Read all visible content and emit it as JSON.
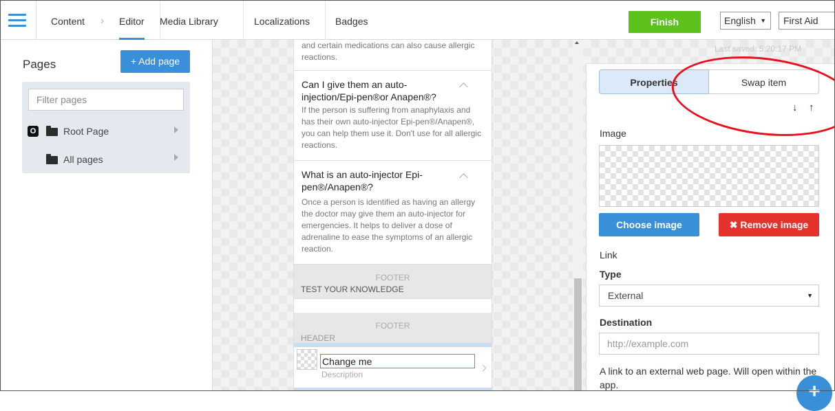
{
  "topbar": {
    "tabs": [
      "Content",
      "Editor",
      "Media Library",
      "Localizations",
      "Badges"
    ],
    "finish_label": "Finish",
    "language": "English",
    "project": "First Aid"
  },
  "sidebar": {
    "title": "Pages",
    "add_label": "+ Add page",
    "filter_placeholder": "Filter pages",
    "badge_letter": "O",
    "root_label": "Root Page",
    "all_label": "All pages"
  },
  "preview": {
    "top_text": "and certain medications can also cause allergic reactions.",
    "item1": {
      "title": "Can I give them an auto-injection/Epi-pen®or Anapen®?",
      "body": "If the person is suffering from anaphylaxis and has their own auto-injector Epi-pen®/Anapen®, you can help them use it. Don't use for all allergic reactions."
    },
    "item2": {
      "title": "What is an auto-injector Epi-pen®/Anapen®?",
      "body": "Once a person is identified as having an allergy the doctor may give them an auto-injector for emergencies. It helps to deliver a dose of adrenaline to ease the symptoms of an allergic reaction."
    },
    "footer_caption": "FOOTER",
    "test_label": "TEST YOUR KNOWLEDGE",
    "header_label": "HEADER",
    "change_value": "Change me",
    "description": "Description"
  },
  "properties": {
    "last_saved": "Last saved: 5:20:17 PM",
    "tab_properties": "Properties",
    "tab_swap": "Swap item",
    "image_label": "Image",
    "choose_label": "Choose image",
    "remove_label": "✖ Remove image",
    "link_label": "Link",
    "type_label": "Type",
    "type_value": "External",
    "destination_label": "Destination",
    "destination_placeholder": "http://example.com",
    "help": "A link to an external web page. Will open within the app."
  },
  "colors": {
    "accent": "#3a8fd9",
    "finish": "#5cc11a",
    "danger": "#e5322d",
    "annotation": "#e8101d"
  }
}
